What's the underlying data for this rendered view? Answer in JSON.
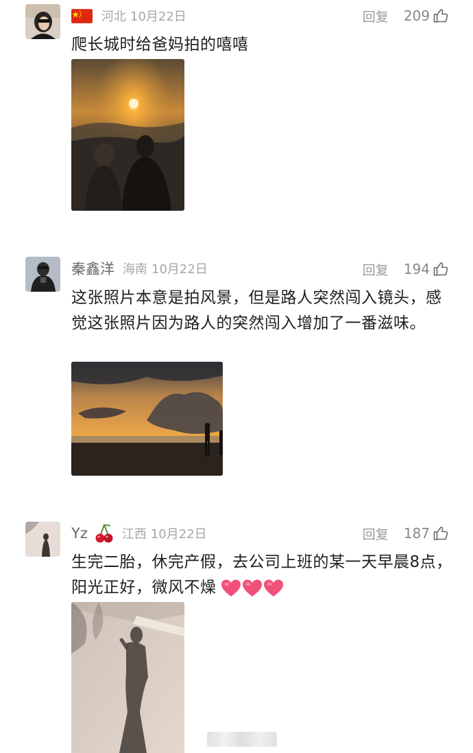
{
  "comments": [
    {
      "username": "",
      "location": "河北",
      "date": "10月22日",
      "reply_label": "回复",
      "likes": "209",
      "text": "爬长城时给爸妈拍的嘻嘻",
      "badge_icon": "china-flag-icon"
    },
    {
      "username": "秦鑫洋",
      "location": "海南",
      "date": "10月22日",
      "reply_label": "回复",
      "likes": "194",
      "text": "这张照片本意是拍风景，但是路人突然闯入镜头，感觉这张照片因为路人的突然闯入增加了一番滋味。"
    },
    {
      "username": "Yz",
      "location": "江西",
      "date": "10月22日",
      "reply_label": "回复",
      "likes": "187",
      "text": "生完二胎，休完产假，去公司上班的某一天早晨8点，阳光正好，微风不燥",
      "badge_icon": "cherry-emoji-icon",
      "text_emoji": [
        "heart-emoji-icon",
        "heart-emoji-icon",
        "heart-emoji-icon"
      ]
    }
  ],
  "colors": {
    "background": "#ffffff",
    "meta_text": "#a6a6a6",
    "body_text": "#1e1e1e",
    "heart": "#f0507a"
  }
}
